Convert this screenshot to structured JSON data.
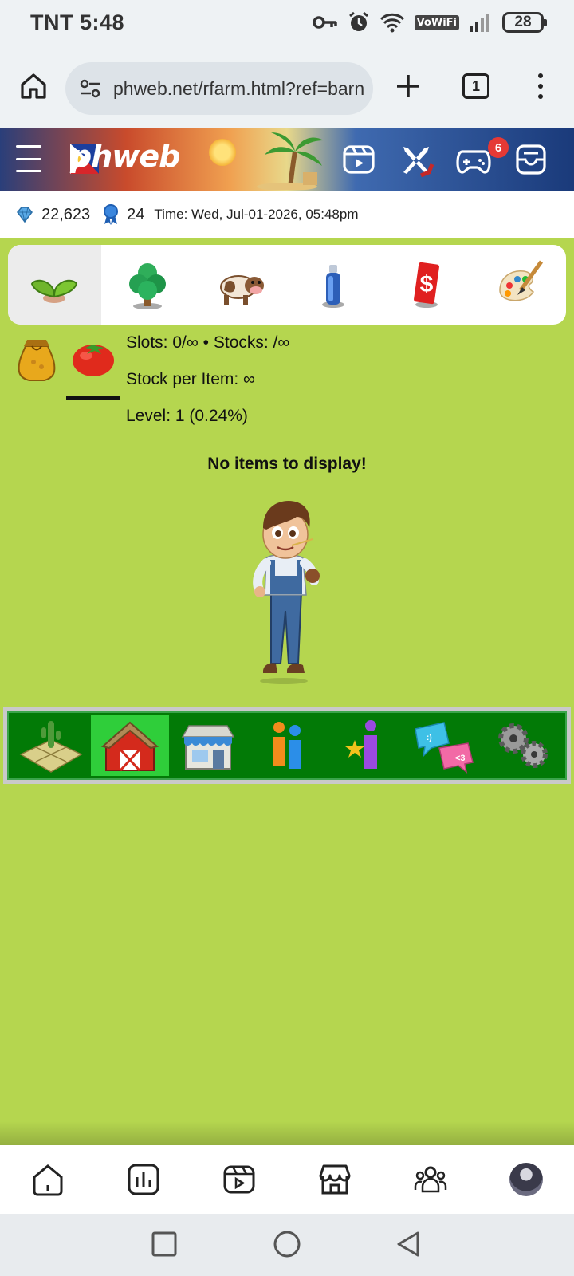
{
  "status_bar": {
    "carrier_time": "TNT 5:48",
    "network": "VoWiFi",
    "battery": "28"
  },
  "browser": {
    "url": "phweb.net/rfarm.html?ref=barn",
    "tab_count": "1"
  },
  "site_header": {
    "logo": "phweb",
    "notification_count": "6"
  },
  "info_bar": {
    "gems": "22,623",
    "ribbons": "24",
    "time": "Time: Wed, Jul-01-2026, 05:48pm"
  },
  "category_tabs": [
    {
      "name": "seedlings",
      "icon": "sprout-icon",
      "active": true
    },
    {
      "name": "trees",
      "icon": "tree-icon",
      "active": false
    },
    {
      "name": "animals",
      "icon": "cow-icon",
      "active": false
    },
    {
      "name": "products",
      "icon": "spray-can-icon",
      "active": false
    },
    {
      "name": "money",
      "icon": "dollar-card-icon",
      "active": false
    },
    {
      "name": "decorations",
      "icon": "palette-icon",
      "active": false
    }
  ],
  "storage": {
    "slots_stocks": "Slots: 0/∞ • Stocks: /∞",
    "stock_per_item": "Stock per Item: ∞",
    "level": "Level: 1 (0.24%)",
    "empty_message": "No items to display!"
  },
  "game_nav": [
    {
      "name": "farm",
      "icon": "farm-plot-icon",
      "active": false
    },
    {
      "name": "barn",
      "icon": "barn-icon",
      "active": true
    },
    {
      "name": "market",
      "icon": "market-icon",
      "active": false
    },
    {
      "name": "neighbors",
      "icon": "people-icon",
      "active": false
    },
    {
      "name": "ranking",
      "icon": "star-person-icon",
      "active": false
    },
    {
      "name": "chat",
      "icon": "chat-bubbles-icon",
      "active": false
    },
    {
      "name": "settings",
      "icon": "gears-icon",
      "active": false
    }
  ],
  "colors": {
    "grass": "#b5d64f",
    "nav_green": "#027a06",
    "nav_active": "#2fce3a"
  }
}
